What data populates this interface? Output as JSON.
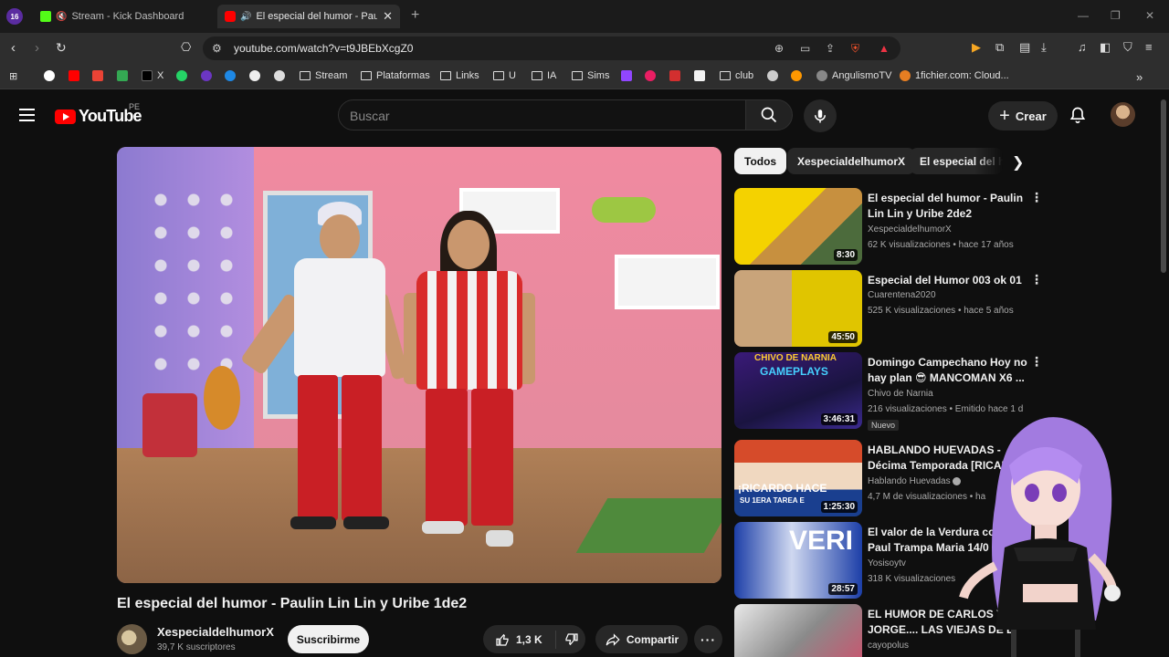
{
  "browser": {
    "tabs": [
      {
        "title": "Stream - Kick Dashboard",
        "favicon": "kick-icon",
        "muted": true
      },
      {
        "title": "El especial del humor - Paulin",
        "favicon": "youtube-icon",
        "audio": true,
        "active": true
      }
    ],
    "url": "youtube.com/watch?v=t9JBEbXcgZ0",
    "bookmarks": [
      {
        "label": "X",
        "icon": "x-icon"
      },
      {
        "label": "Stream",
        "icon": "folder-icon"
      },
      {
        "label": "Plataformas",
        "icon": "folder-icon"
      },
      {
        "label": "Links",
        "icon": "folder-icon"
      },
      {
        "label": "U",
        "icon": "folder-icon"
      },
      {
        "label": "IA",
        "icon": "folder-icon"
      },
      {
        "label": "Sims",
        "icon": "folder-icon"
      },
      {
        "label": "club",
        "icon": "folder-icon"
      },
      {
        "label": "AngulismoTV",
        "icon": "angulismo-icon"
      },
      {
        "label": "1fichier.com: Cloud...",
        "icon": "fichier-icon"
      }
    ]
  },
  "youtube": {
    "logo_text": "YouTube",
    "country": "PE",
    "search_placeholder": "Buscar",
    "create_label": "Crear"
  },
  "video": {
    "title": "El especial del humor - Paulin Lin Lin y Uribe 1de2",
    "channel": "XespecialdelhumorX",
    "subscribers": "39,7 K suscriptores",
    "subscribe_label": "Suscribirme",
    "likes": "1,3 K",
    "share_label": "Compartir"
  },
  "chips": [
    "Todos",
    "XespecialdelhumorX",
    "El especial del humor"
  ],
  "recommendations": [
    {
      "title": "El especial del humor - Paulin Lin Lin y Uribe 2de2",
      "channel": "XespecialdelhumorX",
      "meta": "62 K visualizaciones • hace 17 años",
      "duration": "8:30"
    },
    {
      "title": "Especial del Humor 003 ok 01",
      "channel": "Cuarentena2020",
      "meta": "525 K visualizaciones • hace 5 años",
      "duration": "45:50"
    },
    {
      "title": "Domingo Campechano Hoy no hay plan 😎 MANCOMAN X6 ...",
      "channel": "Chivo de Narnia",
      "meta": "216 visualizaciones • Emitido hace 1 d",
      "duration": "3:46:31",
      "badge": "Nuevo",
      "thumb_text_1": "CHIVO DE NARNIA",
      "thumb_text_2": "GAMEPLAYS"
    },
    {
      "title": "HABLANDO HUEVADAS - Décima Temporada [RICARDO",
      "channel": "Hablando Huevadas",
      "meta": "4,7 M de visualizaciones • ha",
      "duration": "1:25:30",
      "thumb_text_1": "¡RICARDO HACE",
      "thumb_text_2": "SU 1ERA TAREA E"
    },
    {
      "title": "El valor de la Verdura con Paul Trampa Maria 14/0",
      "channel": "Yosisoytv",
      "meta": "318 K visualizaciones",
      "duration": "28:57",
      "thumb_text_1": "VERI"
    },
    {
      "title": "EL HUMOR DE CARLOS Y JORGE.... LAS VIEJAS DE L",
      "channel": "cayopolus",
      "meta": "",
      "duration": ""
    }
  ],
  "colors": {
    "background": "#0f0f0f",
    "brand_red": "#ff0000",
    "chip_bg": "#272727",
    "text_secondary": "#aaaaaa"
  }
}
